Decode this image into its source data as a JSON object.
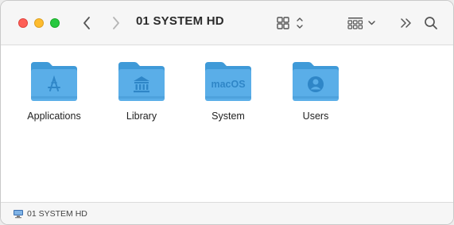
{
  "window": {
    "title": "01 SYSTEM HD"
  },
  "toolbar": {
    "back_icon": "chevron-left-icon",
    "forward_icon": "chevron-right-icon",
    "view_icon": "icon-grid-view-icon",
    "group_icon": "group-by-icon",
    "more_icon": "double-chevron-right-icon",
    "search_icon": "search-icon"
  },
  "items": [
    {
      "label": "Applications",
      "emblem": "app-store-emblem-icon"
    },
    {
      "label": "Library",
      "emblem": "library-emblem-icon"
    },
    {
      "label": "System",
      "emblem": "macOS"
    },
    {
      "label": "Users",
      "emblem": "user-emblem-icon"
    }
  ],
  "statusbar": {
    "path_label": "01 SYSTEM HD"
  },
  "colors": {
    "folder_body": "#5aaee8",
    "folder_tab": "#3f9ad8",
    "emblem": "#2f86c7"
  }
}
